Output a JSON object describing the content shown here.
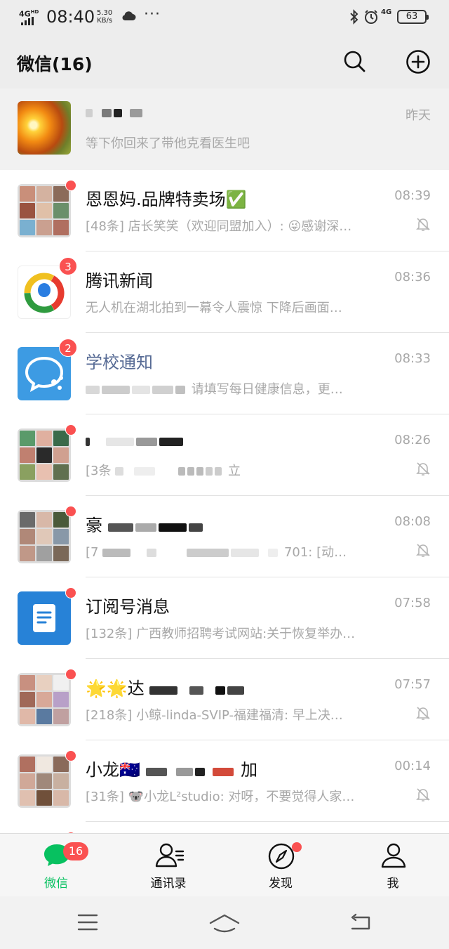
{
  "status_bar": {
    "network": "4G",
    "network_hd": "HD",
    "time": "08:40",
    "speed_value": "5.30",
    "speed_unit": "KB/s",
    "more": "···",
    "signal_right": "4G",
    "battery": "63"
  },
  "header": {
    "title": "微信(16)"
  },
  "chats": [
    {
      "name": "",
      "message": "等下你回来了带他克看医生吧",
      "time": "昨天",
      "muted": false,
      "pinned": true
    },
    {
      "name": "恩恩妈.品牌特卖场✅",
      "message": "[48条] 店长笑笑（欢迎同盟加入）: 😜感谢深…",
      "time": "08:39",
      "muted": true
    },
    {
      "name": "腾讯新闻",
      "message": "无人机在湖北拍到一幕令人震惊 下降后画面…",
      "time": "08:36",
      "muted": false,
      "badge": "3"
    },
    {
      "name": "学校通知",
      "message": "请填写每日健康信息，更…",
      "time": "08:33",
      "muted": false,
      "badge": "2"
    },
    {
      "name": "",
      "message_prefix": "[3条",
      "message_suffix": "立",
      "time": "08:26",
      "muted": true
    },
    {
      "name": "豪",
      "message_prefix": "[7",
      "message_suffix": "701: [动…",
      "time": "08:08",
      "muted": true
    },
    {
      "name": "订阅号消息",
      "message": "[132条] 广西教师招聘考试网站:关于恢复举办…",
      "time": "07:58",
      "muted": false
    },
    {
      "name": "🌟🌟达",
      "message": "[218条] 小鲸-linda-SVIP-福建福清: 早上决…",
      "time": "07:57",
      "muted": true
    },
    {
      "name": "小龙🇦🇺",
      "name_suffix": "加",
      "message": "[31条] 🐨小龙L²studio: 对呀，不要觉得人家…",
      "time": "00:14",
      "muted": true
    }
  ],
  "tabs": [
    {
      "label": "微信",
      "badge": "16",
      "active": true
    },
    {
      "label": "通讯录"
    },
    {
      "label": "发现"
    },
    {
      "label": "我"
    }
  ],
  "colors": {
    "accent": "#07c160",
    "badge": "#fa5151",
    "official_blue": "#576b95",
    "header_bg": "#ededed"
  }
}
